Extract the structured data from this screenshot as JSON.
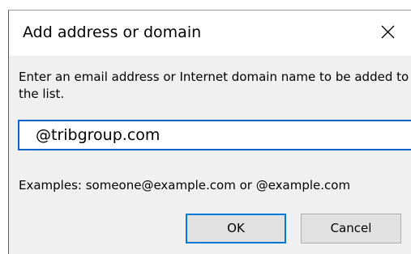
{
  "dialog": {
    "title": "Add address or domain",
    "instruction": "Enter an email address or Internet domain name to be added to the list.",
    "input_value": "@tribgroup.com",
    "examples": "Examples: someone@example.com or @example.com",
    "ok_label": "OK",
    "cancel_label": "Cancel",
    "close_icon": "close-icon"
  },
  "colors": {
    "dialog_background": "#f0f0f0",
    "title_background": "#ffffff",
    "focus_border": "#0078d7",
    "button_background": "#e1e1e1"
  }
}
